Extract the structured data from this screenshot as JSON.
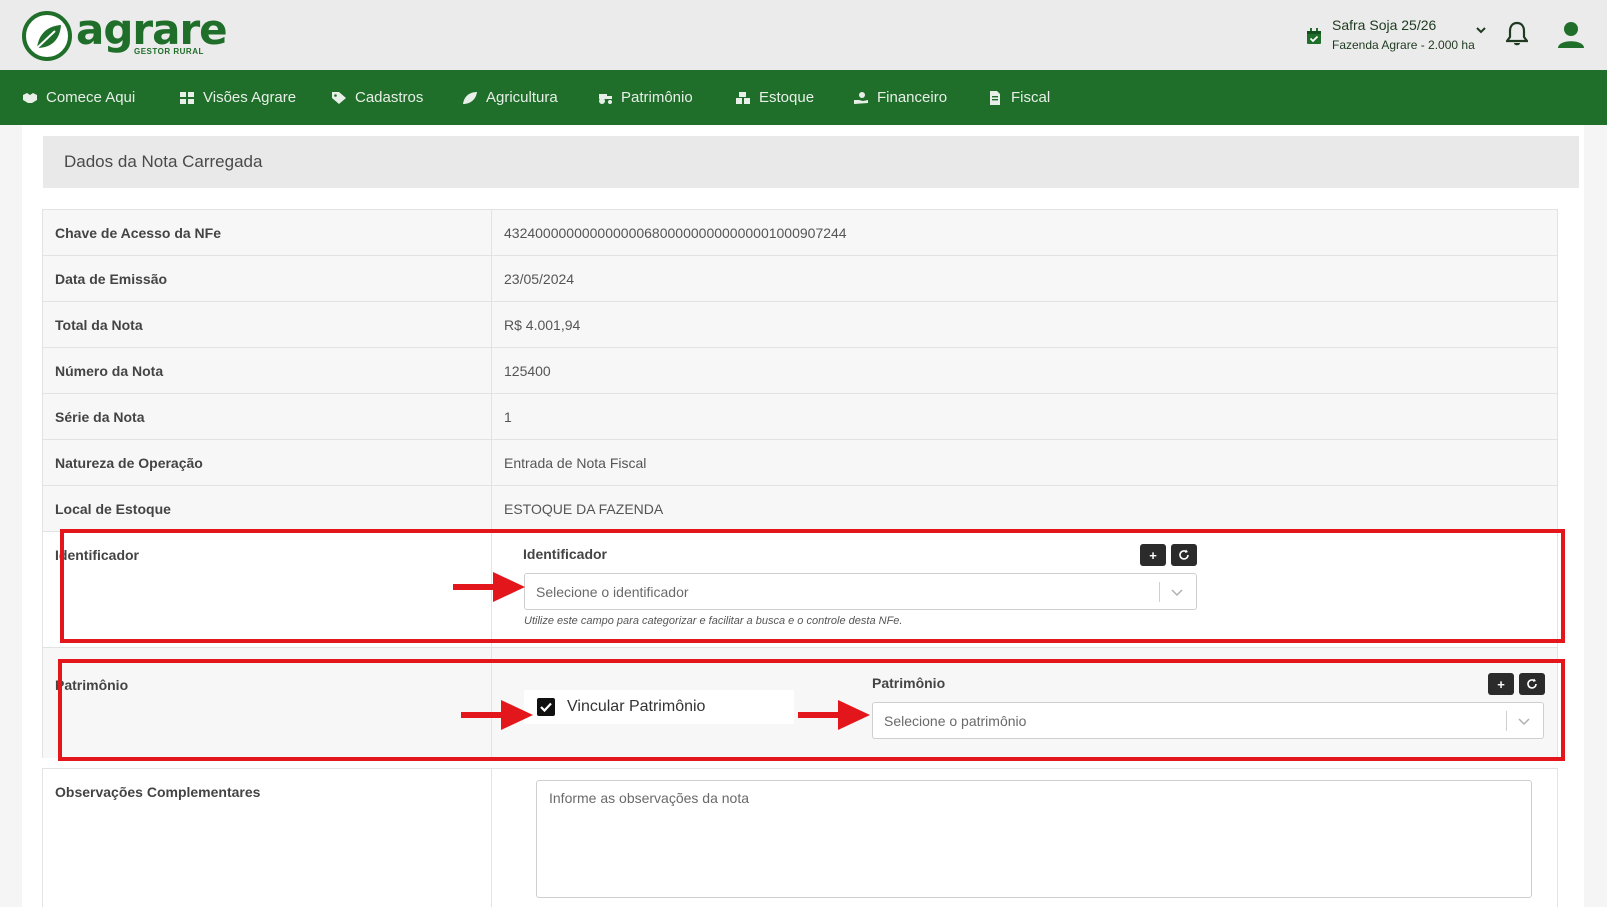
{
  "header": {
    "logo_text": "agrare",
    "logo_subtitle": "GESTOR RURAL",
    "safra_title": "Safra Soja 25/26",
    "safra_subtitle": "Fazenda Agrare - 2.000 ha"
  },
  "nav": [
    {
      "label": "Comece Aqui",
      "icon": "handshake-icon"
    },
    {
      "label": "Visões Agrare",
      "icon": "dashboard-icon"
    },
    {
      "label": "Cadastros",
      "icon": "tag-icon"
    },
    {
      "label": "Agricultura",
      "icon": "leaf-icon"
    },
    {
      "label": "Patrimônio",
      "icon": "tractor-icon"
    },
    {
      "label": "Estoque",
      "icon": "boxes-icon"
    },
    {
      "label": "Financeiro",
      "icon": "money-hand-icon"
    },
    {
      "label": "Fiscal",
      "icon": "document-icon"
    }
  ],
  "card": {
    "title": "Dados da Nota Carregada"
  },
  "rows": [
    {
      "label": "Chave de Acesso da NFe",
      "value": "43240000000000000068000000000000001000907244"
    },
    {
      "label": "Data de Emissão",
      "value": "23/05/2024"
    },
    {
      "label": "Total da Nota",
      "value": "R$ 4.001,94"
    },
    {
      "label": "Número da Nota",
      "value": "125400"
    },
    {
      "label": "Série da Nota",
      "value": "1"
    },
    {
      "label": "Natureza de Operação",
      "value": "Entrada de Nota Fiscal"
    },
    {
      "label": "Local de Estoque",
      "value": "ESTOQUE DA FAZENDA"
    }
  ],
  "identificador": {
    "row_label": "Identificador",
    "field_label": "Identificador",
    "placeholder": "Selecione o identificador",
    "help": "Utilize este campo para categorizar e facilitar a busca e o controle desta NFe.",
    "add_label": "+"
  },
  "patrimonio": {
    "row_label": "Patrimônio",
    "field_label": "Patrimônio",
    "checkbox_label": "Vincular Patrimônio",
    "checkbox_checked": true,
    "placeholder": "Selecione o patrimônio",
    "add_label": "+"
  },
  "observacoes": {
    "row_label": "Observações Complementares",
    "placeholder": "Informe as observações da nota"
  },
  "colors": {
    "brand_green": "#1f6e2a",
    "highlight_red": "#e3161b"
  }
}
